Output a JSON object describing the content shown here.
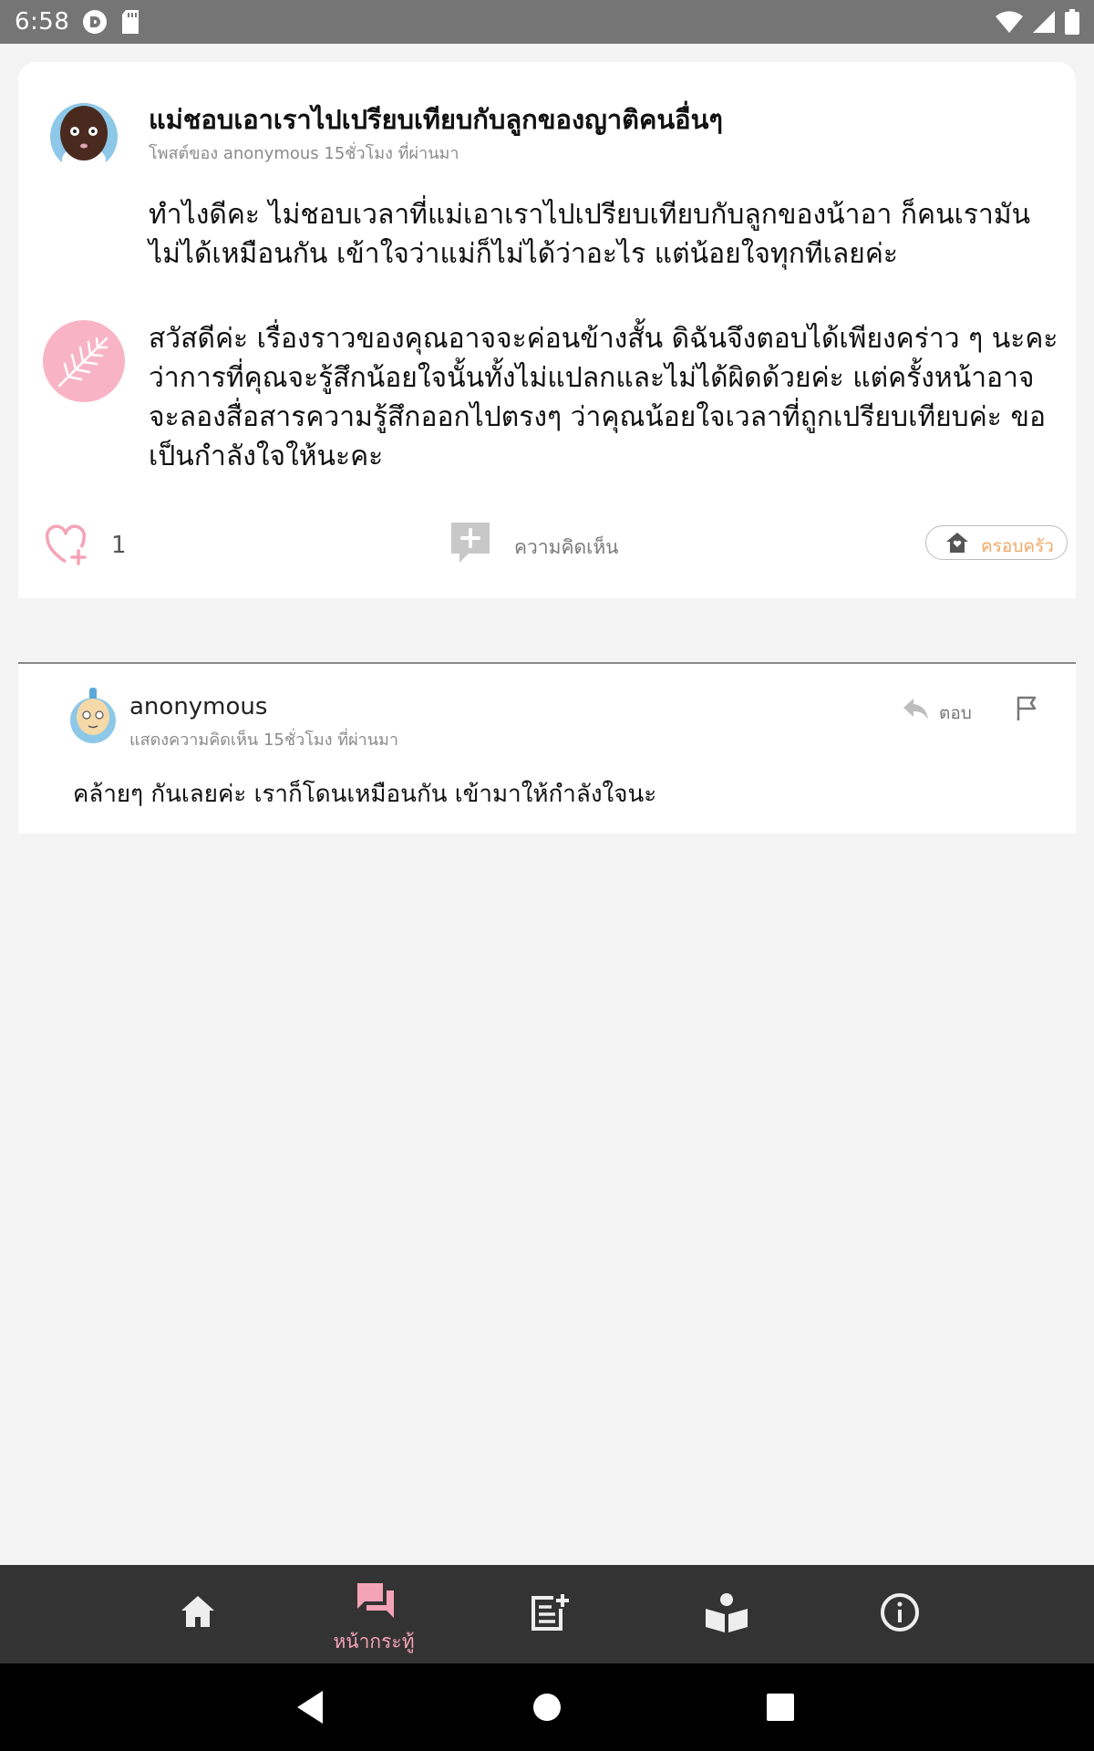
{
  "status_bar": {
    "time": "6:58",
    "left_icons": [
      "pocket-casts-icon",
      "sd-card-icon"
    ],
    "right_icons": [
      "wifi-icon",
      "signal-icon",
      "battery-icon"
    ]
  },
  "post": {
    "title": "แม่ชอบเอาเราไปเปรียบเทียบกับลูกของญาติคนอื่นๆ",
    "meta": "โพสต์ของ anonymous 15ชั่วโมง ที่ผ่านมา",
    "body": "ทำไงดีคะ ไม่ชอบเวลาที่แม่เอาเราไปเปรียบเทียบกับลูกของน้าอา ก็คนเรามันไม่ได้เหมือนกัน เข้าใจว่าแม่ก็ไม่ได้ว่าอะไร แต่น้อยใจทุกทีเลยค่ะ",
    "reply_text": "สวัสดีค่ะ เรื่องราวของคุณอาจจะค่อนข้างสั้น ดิฉันจึงตอบได้เพียงคร่าว ๆ นะคะว่าการที่คุณจะรู้สึกน้อยใจนั้นทั้งไม่แปลกและไม่ได้ผิดด้วยค่ะ แต่ครั้งหน้าอาจจะลองสื่อสารความรู้สึกออกไปตรงๆ ว่าคุณน้อยใจเวลาที่ถูกเปรียบเทียบค่ะ ขอเป็นกำลังใจให้นะคะ",
    "like_count": "1",
    "comment_label": "ความคิดเห็น",
    "category": "ครอบครัว",
    "colors": {
      "accent_pink": "#f5a3b6",
      "category_orange": "#f0a868"
    }
  },
  "comment": {
    "author": "anonymous",
    "meta": "แสดงความคิดเห็น 15ชั่วโมง ที่ผ่านมา",
    "reply_label": "ตอบ",
    "text": "คล้ายๆ กันเลยค่ะ เราก็โดนเหมือนกัน เข้ามาให้กำลังใจนะ"
  },
  "tab_bar": {
    "tabs": [
      {
        "icon": "home-icon",
        "label": ""
      },
      {
        "icon": "forum-icon",
        "label": "หน้ากระทู้",
        "active": true
      },
      {
        "icon": "post-add-icon",
        "label": ""
      },
      {
        "icon": "book-reader-icon",
        "label": ""
      },
      {
        "icon": "info-icon",
        "label": ""
      }
    ]
  },
  "nav_bar": {
    "buttons": [
      "back-icon",
      "home-circle-icon",
      "recents-icon"
    ]
  }
}
